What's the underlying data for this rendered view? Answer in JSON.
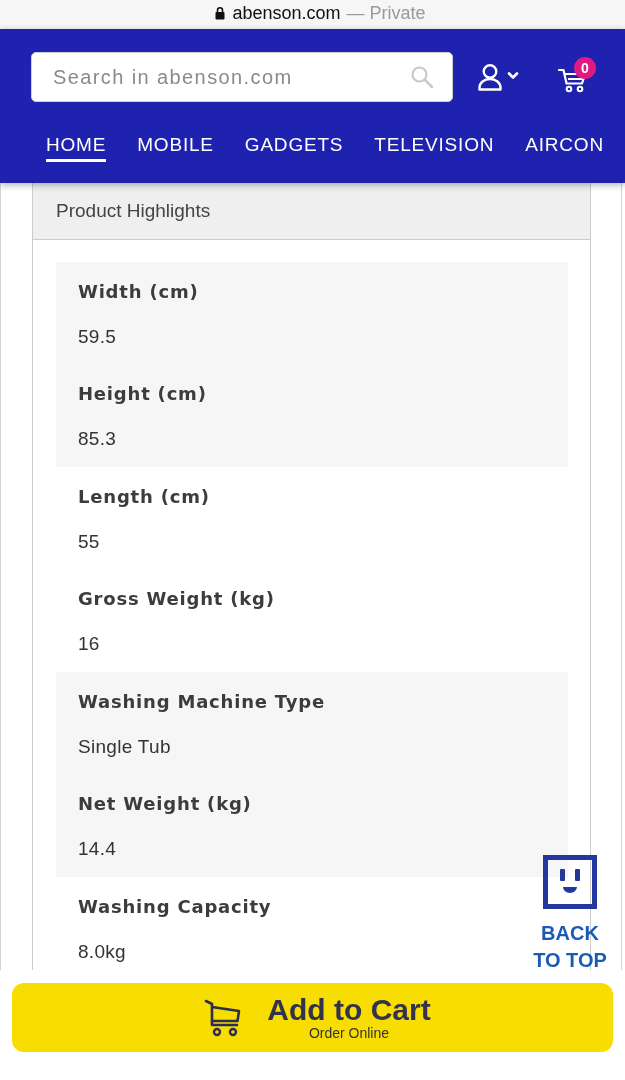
{
  "browser_bar": {
    "domain": "abenson.com",
    "note": "— Private"
  },
  "header": {
    "search": {
      "placeholder": "Search in abenson.com"
    },
    "cart": {
      "count": "0"
    },
    "nav": [
      {
        "label": "HOME",
        "selected": true
      },
      {
        "label": "MOBILE",
        "selected": false
      },
      {
        "label": "GADGETS",
        "selected": false
      },
      {
        "label": "TELEVISION",
        "selected": false
      },
      {
        "label": "AIRCON",
        "selected": false
      }
    ]
  },
  "panel": {
    "title": "Product Highlights",
    "groups": [
      {
        "specs": [
          {
            "label": "Width (cm)",
            "value": "59.5"
          },
          {
            "label": "Height (cm)",
            "value": "85.3"
          }
        ]
      },
      {
        "specs": [
          {
            "label": "Length (cm)",
            "value": "55"
          },
          {
            "label": "Gross Weight (kg)",
            "value": "16"
          }
        ]
      },
      {
        "specs": [
          {
            "label": "Washing Machine Type",
            "value": "Single Tub"
          },
          {
            "label": "Net Weight (kg)",
            "value": "14.4"
          }
        ]
      },
      {
        "specs": [
          {
            "label": "Washing Capacity",
            "value": "8.0kg"
          }
        ]
      }
    ]
  },
  "back_to_top": {
    "lines": [
      "BACK",
      "TO TOP"
    ]
  },
  "add_to_cart": {
    "label": "Add to Cart",
    "sublabel": "Order Online"
  }
}
